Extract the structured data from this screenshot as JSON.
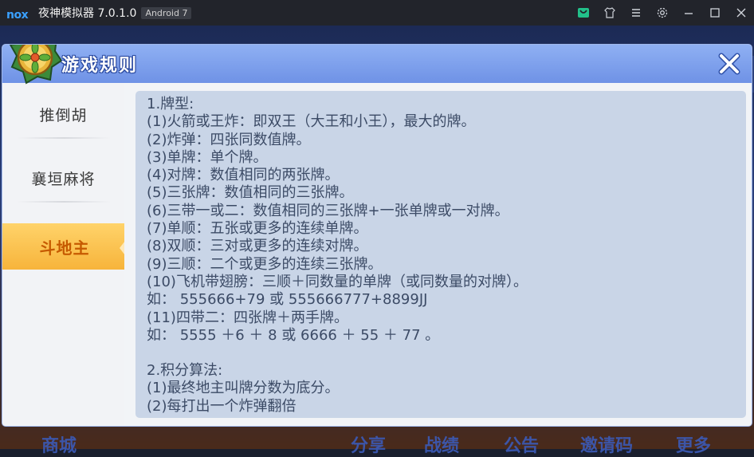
{
  "window": {
    "logo_text": "nox",
    "title": "夜神模拟器 7.0.1.0",
    "android_badge": "Android 7"
  },
  "dialog": {
    "title": "游戏规则"
  },
  "sidebar": {
    "items": [
      {
        "label": "推倒胡",
        "active": false
      },
      {
        "label": "襄垣麻将",
        "active": false
      },
      {
        "label": "斗地主",
        "active": true
      }
    ]
  },
  "rules": {
    "section1": {
      "heading": "1.牌型:",
      "lines": [
        "(1)火箭或王炸：即双王（大王和小王），最大的牌。",
        "(2)炸弹：四张同数值牌。",
        "(3)单牌：单个牌。",
        "(4)对牌：数值相同的两张牌。",
        "(5)三张牌：数值相同的三张牌。",
        "(6)三带一或二：数值相同的三张牌+一张单牌或一对牌。",
        "(7)单顺：五张或更多的连续单牌。",
        "(8)双顺：三对或更多的连续对牌。",
        "(9)三顺：二个或更多的连续三张牌。",
        "(10)飞机带翅膀：三顺＋同数量的单牌（或同数量的对牌）。",
        "如： 555666+79 或 555666777+8899JJ",
        "(11)四带二：四张牌＋两手牌。",
        "如： 5555 ＋6 ＋ 8 或 6666 ＋ 55 ＋ 77 。"
      ]
    },
    "section2": {
      "heading": "2.积分算法:",
      "lines": [
        "(1)最终地主叫牌分数为底分。",
        "(2)每打出一个炸弹翻倍"
      ]
    }
  },
  "background_nav": [
    "商城",
    "分享",
    "战绩",
    "公告",
    "邀请码",
    "更多"
  ]
}
